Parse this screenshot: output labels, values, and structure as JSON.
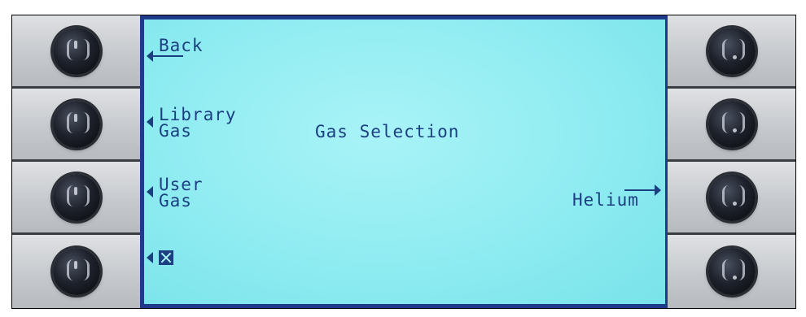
{
  "screen": {
    "title": "Gas Selection",
    "softkeys": {
      "left": [
        {
          "lines": [
            "Back"
          ],
          "icon": null
        },
        {
          "lines": [
            "Library",
            "Gas"
          ],
          "icon": null
        },
        {
          "lines": [
            "User",
            "Gas"
          ],
          "icon": null
        },
        {
          "lines": [],
          "icon": "close-icon"
        }
      ],
      "right": [
        {
          "lines": []
        },
        {
          "lines": []
        },
        {
          "lines": [
            "Helium"
          ]
        },
        {
          "lines": []
        }
      ]
    }
  },
  "colors": {
    "lcd_background": "#8eecf1",
    "lcd_text": "#1b3f80",
    "screen_frame": "#1e3a8a",
    "bezel": "#c9ccd1",
    "knob": "#1e222c"
  }
}
